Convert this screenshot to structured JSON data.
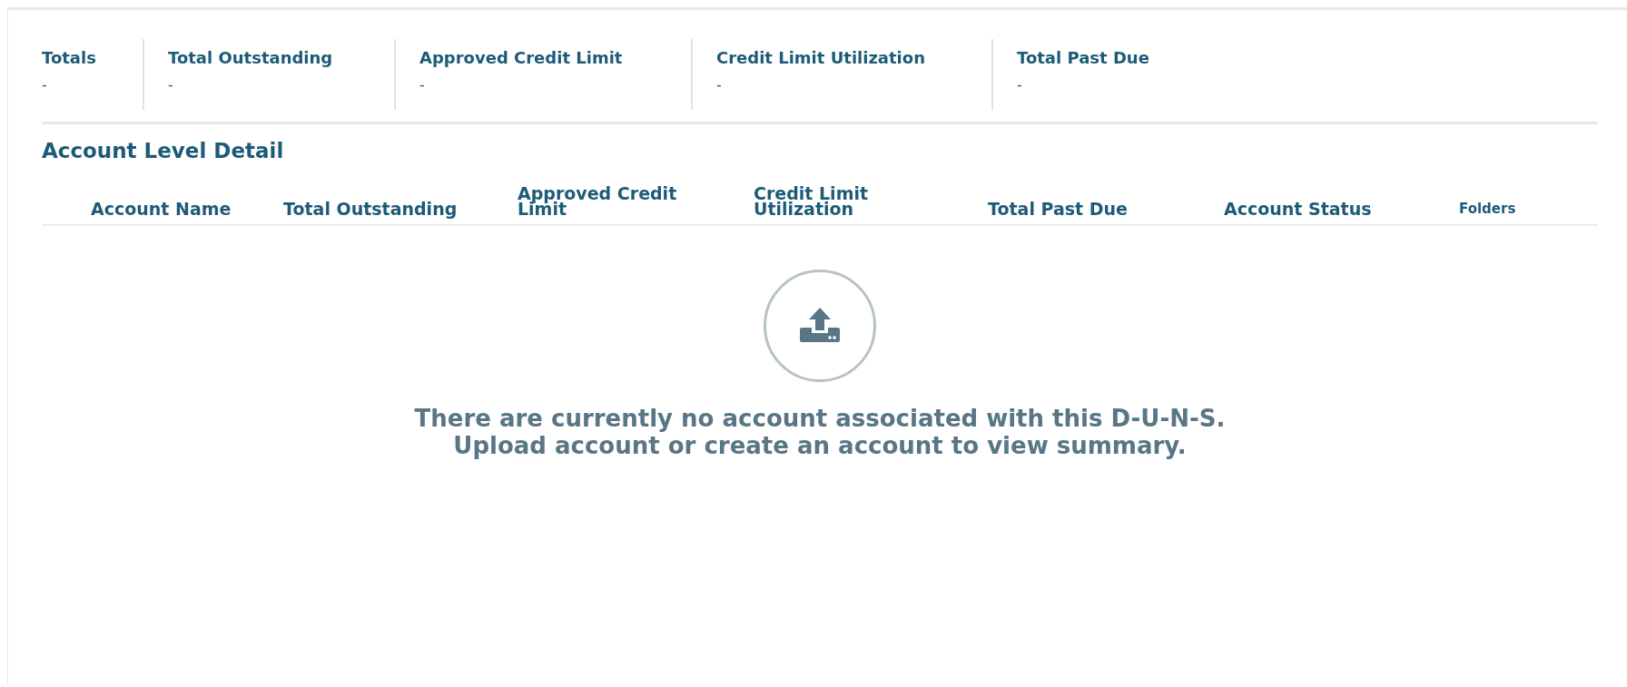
{
  "summary": [
    {
      "label": "Totals",
      "value": "-"
    },
    {
      "label": "Total Outstanding",
      "value": "-"
    },
    {
      "label": "Approved Credit Limit",
      "value": "-"
    },
    {
      "label": "Credit Limit Utilization",
      "value": "-"
    },
    {
      "label": "Total Past Due",
      "value": "-"
    }
  ],
  "section_title": "Account Level Detail",
  "table": {
    "columns": [
      {
        "label": "Account Name",
        "kind": "main"
      },
      {
        "label": "Total Outstanding",
        "kind": "main"
      },
      {
        "label": "Approved Credit Limit",
        "kind": "main"
      },
      {
        "label": "Credit Limit Utilization",
        "kind": "main"
      },
      {
        "label": "Total Past Due",
        "kind": "main"
      },
      {
        "label": "Account Status",
        "kind": "main"
      },
      {
        "label": "Folders",
        "kind": "minor"
      }
    ]
  },
  "empty_state": {
    "message": "There are currently no account associated with this D-U-N-S. Upload account or create an account to view summary."
  }
}
